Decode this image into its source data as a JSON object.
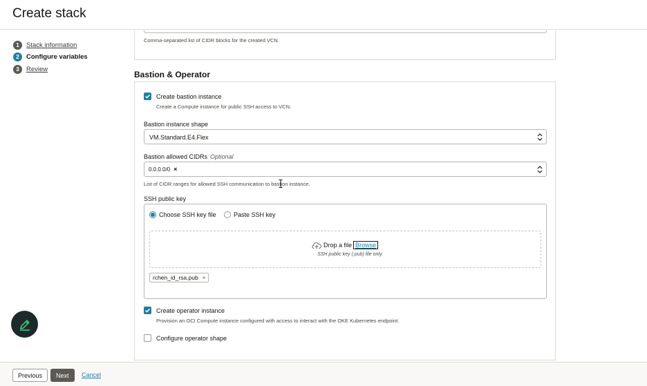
{
  "header": {
    "title": "Create stack"
  },
  "steps": [
    {
      "num": "1",
      "label": "Stack information",
      "state": "done"
    },
    {
      "num": "2",
      "label": "Configure variables",
      "state": "current"
    },
    {
      "num": "3",
      "label": "Review",
      "state": "todo"
    }
  ],
  "top_card": {
    "help": "Comma-separated list of CIDR blocks for the created VCN."
  },
  "section": {
    "title": "Bastion & Operator"
  },
  "bastion": {
    "create_label": "Create bastion instance",
    "create_help": "Create a Compute instance for public SSH access to VCN.",
    "create_checked": true,
    "shape_label": "Bastion instance shape",
    "shape_value": "VM.Standard.E4.Flex",
    "cidrs_label": "Bastion allowed CIDRs",
    "cidrs_optional": "Optional",
    "cidrs_chip": "0.0.0.0/0",
    "cidrs_chip_remove": "×",
    "cidrs_help": "List of CIDR ranges for allowed SSH communication to bastion instance."
  },
  "ssh": {
    "label": "SSH public key",
    "option_file": "Choose SSH key file",
    "option_paste": "Paste SSH key",
    "selected": "file",
    "drop_text": "Drop a file",
    "browse": "Browse",
    "drop_help": "SSH public key (.pub) file only.",
    "file_name": "rchen_id_rsa.pub",
    "file_remove": "×"
  },
  "operator": {
    "create_label": "Create operator instance",
    "create_help": "Provision an OCI Compute instance configured with access to interact with the OKE Kubernetes endpoint.",
    "create_checked": true,
    "shape_label": "Configure operator shape",
    "shape_checked": false
  },
  "footer": {
    "previous": "Previous",
    "next": "Next",
    "cancel": "Cancel"
  },
  "icons": {
    "fab": "pencil-icon",
    "upload": "cloud-upload-icon",
    "check": "check-icon",
    "select": "chevron-up-down-icon"
  },
  "colors": {
    "accent": "#227e9e",
    "fab_bg": "#1e2a2a",
    "fab_icon": "#3fd28a",
    "next_bg": "#5c5955"
  }
}
